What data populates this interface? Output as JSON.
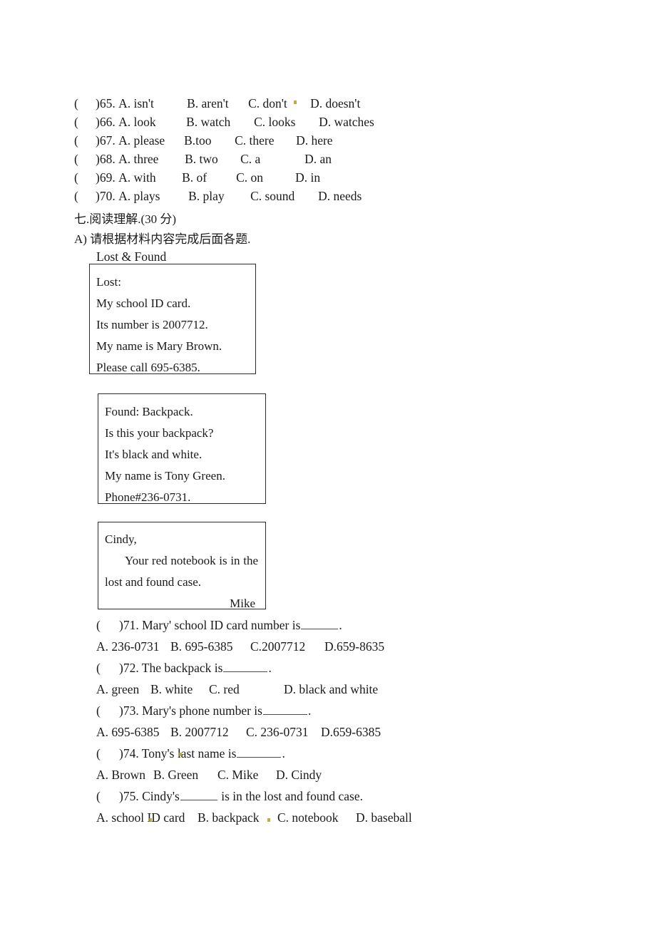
{
  "document": {
    "cloze_questions": [
      {
        "paren": "(",
        "number": ")65.",
        "options": [
          "A. isn't",
          "B. aren't",
          "C. don't",
          "D. doesn't"
        ]
      },
      {
        "paren": "(",
        "number": ")66.",
        "options": [
          "A. look",
          "B. watch",
          "C. looks",
          "D. watches"
        ]
      },
      {
        "paren": "(",
        "number": ")67.",
        "options": [
          "A. please",
          "B.too",
          "C. there",
          "D. here"
        ]
      },
      {
        "paren": "(",
        "number": ")68.",
        "options": [
          "A. three",
          "B. two",
          "C. a",
          "D. an"
        ]
      },
      {
        "paren": "(",
        "number": ")69.",
        "options": [
          "A. with",
          "B. of",
          "C. on",
          "D. in"
        ]
      },
      {
        "paren": "(",
        "number": ")70.",
        "options": [
          "A. plays",
          "B. play",
          "C. sound",
          "D. needs"
        ]
      }
    ],
    "section_heading": "七.阅读理解.(30 分)",
    "part_a_heading": "A) 请根据材料内容完成后面各题.",
    "passage_title": "Lost & Found",
    "notices": {
      "lost": {
        "lines": [
          "Lost:",
          "My school ID card.",
          "Its number is 2007712.",
          "My name is Mary Brown.",
          "Please call 695-6385."
        ]
      },
      "found": {
        "lines": [
          "Found: Backpack.",
          "Is this your backpack?",
          "It's black and white.",
          "My name is Tony Green.",
          "Phone#236-0731."
        ]
      },
      "cindy": {
        "greeting": "Cindy,",
        "body_line1": "Your red notebook is in the",
        "body_line2": "lost and found case.",
        "signature": "Mike"
      }
    },
    "reading_questions": [
      {
        "paren": "(",
        "stem_before": ")71. Mary' school ID card number is",
        "stem_after": ".",
        "options": [
          "A.  236-0731",
          "B. 695-6385",
          "C.2007712",
          "D.659-8635"
        ]
      },
      {
        "paren": "(",
        "stem_before": ")72. The backpack is",
        "stem_after": ".",
        "options": [
          "A.  green",
          "B. white",
          "C. red",
          "D. black and white"
        ]
      },
      {
        "paren": "(",
        "stem_before": ")73. Mary's phone number is",
        "stem_after": ".",
        "options": [
          "A.  695-6385",
          "B. 2007712",
          "C. 236-0731",
          "D.659-6385"
        ]
      },
      {
        "paren": "(",
        "stem_before": ")74. Tony's  last name is",
        "stem_after": ".",
        "options": [
          "A.  Brown",
          "B. Green",
          "C. Mike",
          "D. Cindy"
        ]
      },
      {
        "paren": "(",
        "stem_before": ")75. Cindy's",
        "stem_after": "is in the lost and found case.",
        "options": [
          "A.  school ID card",
          "B. backpack",
          "C. notebook",
          "D. baseball"
        ]
      }
    ]
  }
}
